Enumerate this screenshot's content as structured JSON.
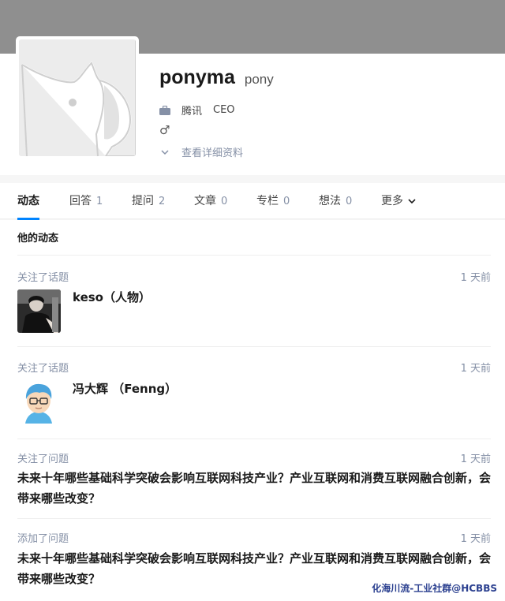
{
  "profile": {
    "name": "ponyma",
    "headline": "pony",
    "company": "腾讯",
    "position": "CEO",
    "gender_symbol": "♂",
    "view_details_label": "查看详细资料"
  },
  "tabs": [
    {
      "label": "动态",
      "count": ""
    },
    {
      "label": "回答",
      "count": "1"
    },
    {
      "label": "提问",
      "count": "2"
    },
    {
      "label": "文章",
      "count": "0"
    },
    {
      "label": "专栏",
      "count": "0"
    },
    {
      "label": "想法",
      "count": "0"
    },
    {
      "label": "更多",
      "count": ""
    }
  ],
  "feed": {
    "header": "他的动态",
    "items": [
      {
        "action": "关注了话题",
        "time": "1 天前",
        "title": "keso（人物）",
        "icon": "topic-avatar-photo"
      },
      {
        "action": "关注了话题",
        "time": "1 天前",
        "title": "冯大辉 （Fenng）",
        "icon": "topic-avatar-cartoon"
      },
      {
        "action": "关注了问题",
        "time": "1 天前",
        "title": "未来十年哪些基础科学突破会影响互联网科技产业？产业互联网和消费互联网融合创新，会带来哪些改变？"
      },
      {
        "action": "添加了问题",
        "time": "1 天前",
        "title": "未来十年哪些基础科学突破会影响互联网科技产业？产业互联网和消费互联网融合创新，会带来哪些改变？"
      }
    ]
  },
  "watermark": "化海川流-工业社群@HCBBS",
  "colors": {
    "accent": "#0084ff",
    "cover": "#8f8f8f",
    "muted": "#8590a6"
  }
}
